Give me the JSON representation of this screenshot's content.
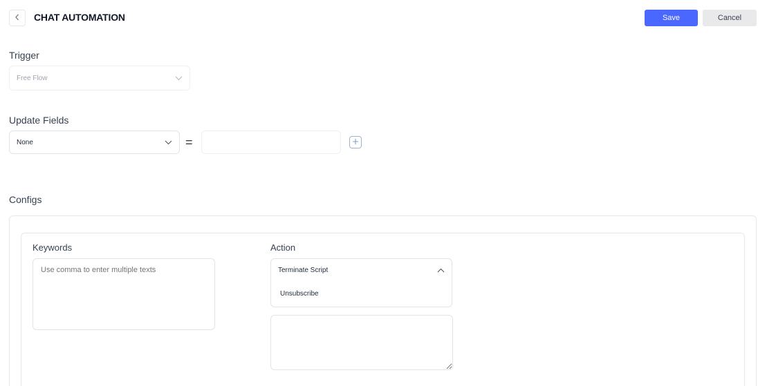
{
  "header": {
    "title": "CHAT AUTOMATION",
    "save_label": "Save",
    "cancel_label": "Cancel"
  },
  "trigger": {
    "label": "Trigger",
    "value": "Free Flow",
    "disabled": true
  },
  "update_fields": {
    "label": "Update Fields",
    "field_value": "None",
    "operator": "=",
    "input_value": ""
  },
  "configs": {
    "label": "Configs",
    "keywords": {
      "label": "Keywords",
      "placeholder": "Use comma to enter multiple texts"
    },
    "action": {
      "label": "Action",
      "selected": "Terminate Script",
      "options": [
        "Unsubscribe"
      ],
      "expanded": true
    },
    "reply_message": {
      "input_value": ""
    }
  },
  "colors": {
    "primary": "#4a67ff",
    "cancel_bg": "#e9e9ec",
    "border": "#e5e7eb"
  },
  "icons": {
    "back": "chevron-left-icon",
    "dropdown": "chevron-down-icon",
    "dropdown_open": "chevron-up-icon",
    "add": "plus-icon"
  }
}
